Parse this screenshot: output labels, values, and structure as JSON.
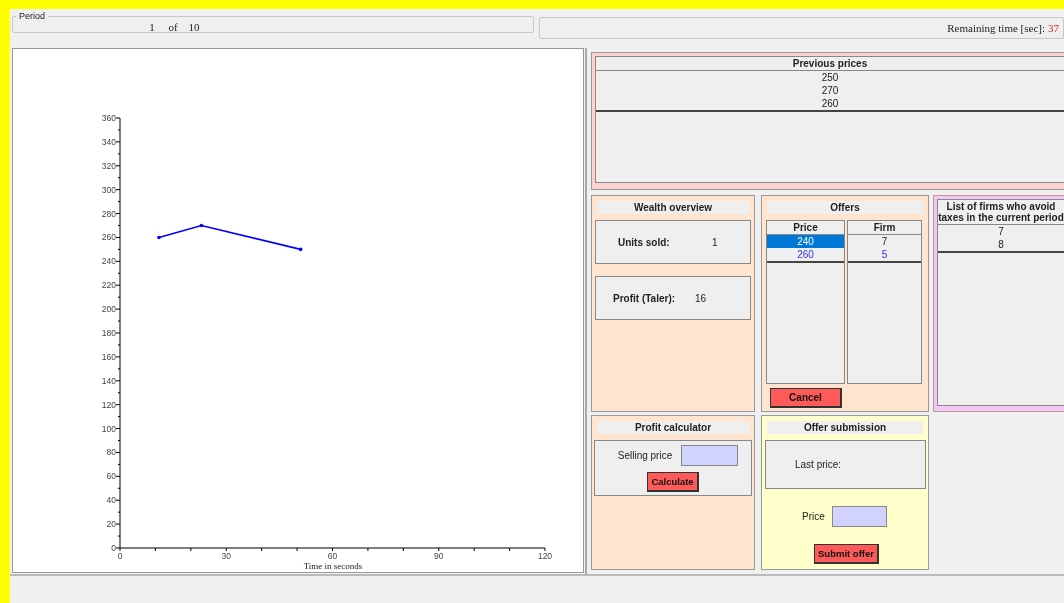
{
  "period": {
    "legend": "Period",
    "current": "1",
    "of": "of",
    "total": "10"
  },
  "timer": {
    "label": "Remaining time [sec]:",
    "value": "37"
  },
  "chart": {
    "chart_data": {
      "type": "line",
      "xlabel": "Time in seconds",
      "x": [
        11,
        23,
        51
      ],
      "series": [
        {
          "color": "#0000ff",
          "values": [
            260,
            270,
            250
          ]
        }
      ],
      "xlim": [
        0,
        120
      ],
      "ylim": [
        0,
        360
      ],
      "xticks": [
        0,
        30,
        60,
        90,
        120
      ],
      "yticks": [
        0,
        20,
        40,
        60,
        80,
        100,
        120,
        140,
        160,
        180,
        200,
        220,
        240,
        260,
        280,
        300,
        320,
        340,
        360
      ]
    }
  },
  "previous_prices": {
    "title": "Previous prices",
    "rows": [
      "250",
      "270",
      "260"
    ]
  },
  "wealth_overview": {
    "title": "Wealth overview",
    "items": [
      {
        "label": "Units sold:",
        "value": "1"
      },
      {
        "label": "Profit (Taler):",
        "value": "16"
      }
    ]
  },
  "offers": {
    "title": "Offers",
    "columns": [
      "Price",
      "Firm"
    ],
    "rows": [
      {
        "price": "240",
        "firm": "7",
        "selected": true
      },
      {
        "price": "260",
        "firm": "5",
        "selected": false
      }
    ],
    "cancel_button": "Cancel"
  },
  "tax_avoiders": {
    "title": "List of firms who avoid taxes in the current period",
    "rows": [
      "7",
      "8"
    ]
  },
  "profit_calculator": {
    "title": "Profit calculator",
    "field_label": "Selling price",
    "button": "Calculate"
  },
  "offer_submission": {
    "title": "Offer submission",
    "last_price_label": "Last price:",
    "price_label": "Price",
    "button": "Submit offer"
  }
}
